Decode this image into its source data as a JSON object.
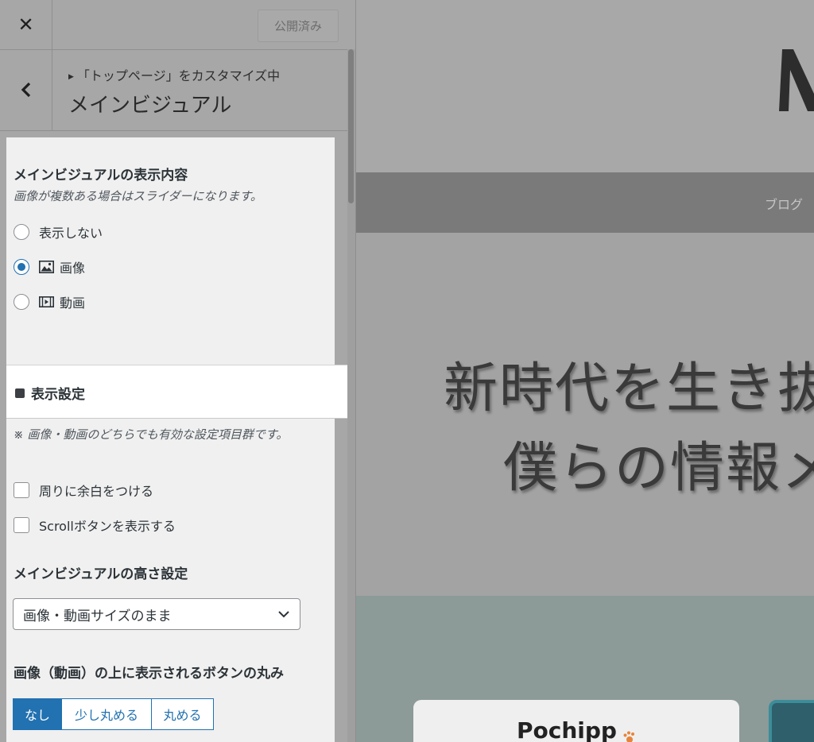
{
  "topbar": {
    "close_symbol": "✕",
    "publish_label": "公開済み"
  },
  "section": {
    "back_symbol": "<",
    "breadcrumb": "「トップページ」をカスタマイズ中",
    "title": "メインビジュアル"
  },
  "display_content": {
    "title": "メインビジュアルの表示内容",
    "description": "画像が複数ある場合はスライダーになります。",
    "options": [
      {
        "label": "表示しない",
        "icon": "",
        "checked": false
      },
      {
        "label": "画像",
        "icon": "image-icon",
        "checked": true
      },
      {
        "label": "動画",
        "icon": "video-icon",
        "checked": false
      }
    ]
  },
  "display_settings": {
    "heading": "表示設定",
    "note": "※ 画像・動画のどちらでも有効な設定項目群です。",
    "checkboxes": [
      {
        "label": "周りに余白をつける",
        "checked": false
      },
      {
        "label": "Scrollボタンを表示する",
        "checked": false
      }
    ]
  },
  "height": {
    "title": "メインビジュアルの高さ設定",
    "selected": "画像・動画サイズのまま"
  },
  "button_radius": {
    "title": "画像（動画）の上に表示されるボタンの丸み",
    "options": [
      "なし",
      "少し丸める",
      "丸める"
    ],
    "active": "なし"
  },
  "preview": {
    "nav_item": "ブログ",
    "hero_line1": "新時代を生き抜",
    "hero_line2": "僕らの情報メ",
    "card_brand": "Pochipp"
  },
  "colors": {
    "accent": "#2271b1",
    "panel_overlay": "#a7a7a7",
    "card_background": "#f0f0f0"
  }
}
